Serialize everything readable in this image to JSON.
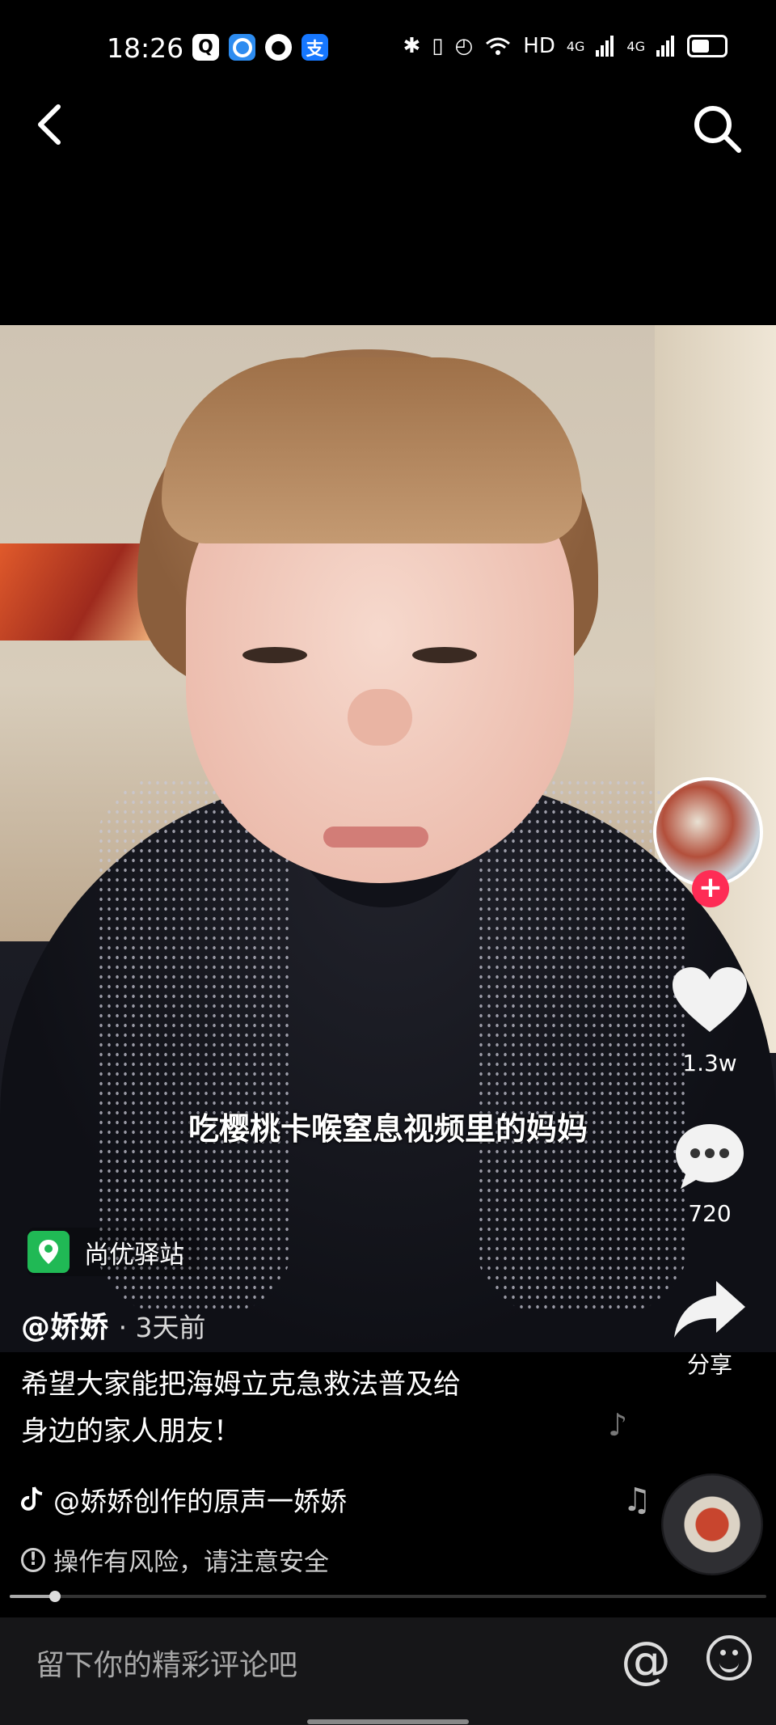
{
  "status_bar": {
    "time": "18:26",
    "network_label": "HD",
    "signal1_label": "4G",
    "signal2_label": "4G",
    "battery_level": 0.55,
    "app_icons": [
      "q-app-icon",
      "browser-icon",
      "camera-app-icon",
      "alipay-icon"
    ],
    "alipay_glyph": "支"
  },
  "nav": {
    "back_icon": "back-arrow-icon",
    "search_icon": "search-icon"
  },
  "video": {
    "subtitle": "吃樱桃卡喉窒息视频里的妈妈"
  },
  "location": {
    "icon": "location-pin-icon",
    "label": "尚优驿站"
  },
  "post": {
    "author": "@娇娇",
    "time_ago": "· 3天前",
    "description_line1": "希望大家能把海姆立克急救法普及给",
    "description_line2": "身边的家人朋友！",
    "music": "@娇娇创作的原声一娇娇",
    "risk_warning": "操作有风险，请注意安全"
  },
  "actions": {
    "follow_glyph": "+",
    "likes": "1.3w",
    "comments": "720",
    "share": "分享"
  },
  "playback": {
    "progress": 0.06
  },
  "comment_bar": {
    "placeholder": "留下你的精彩评论吧",
    "at_glyph": "@"
  },
  "colors": {
    "accent": "#fe2c55",
    "location_green": "#20b955",
    "background": "#000000"
  }
}
